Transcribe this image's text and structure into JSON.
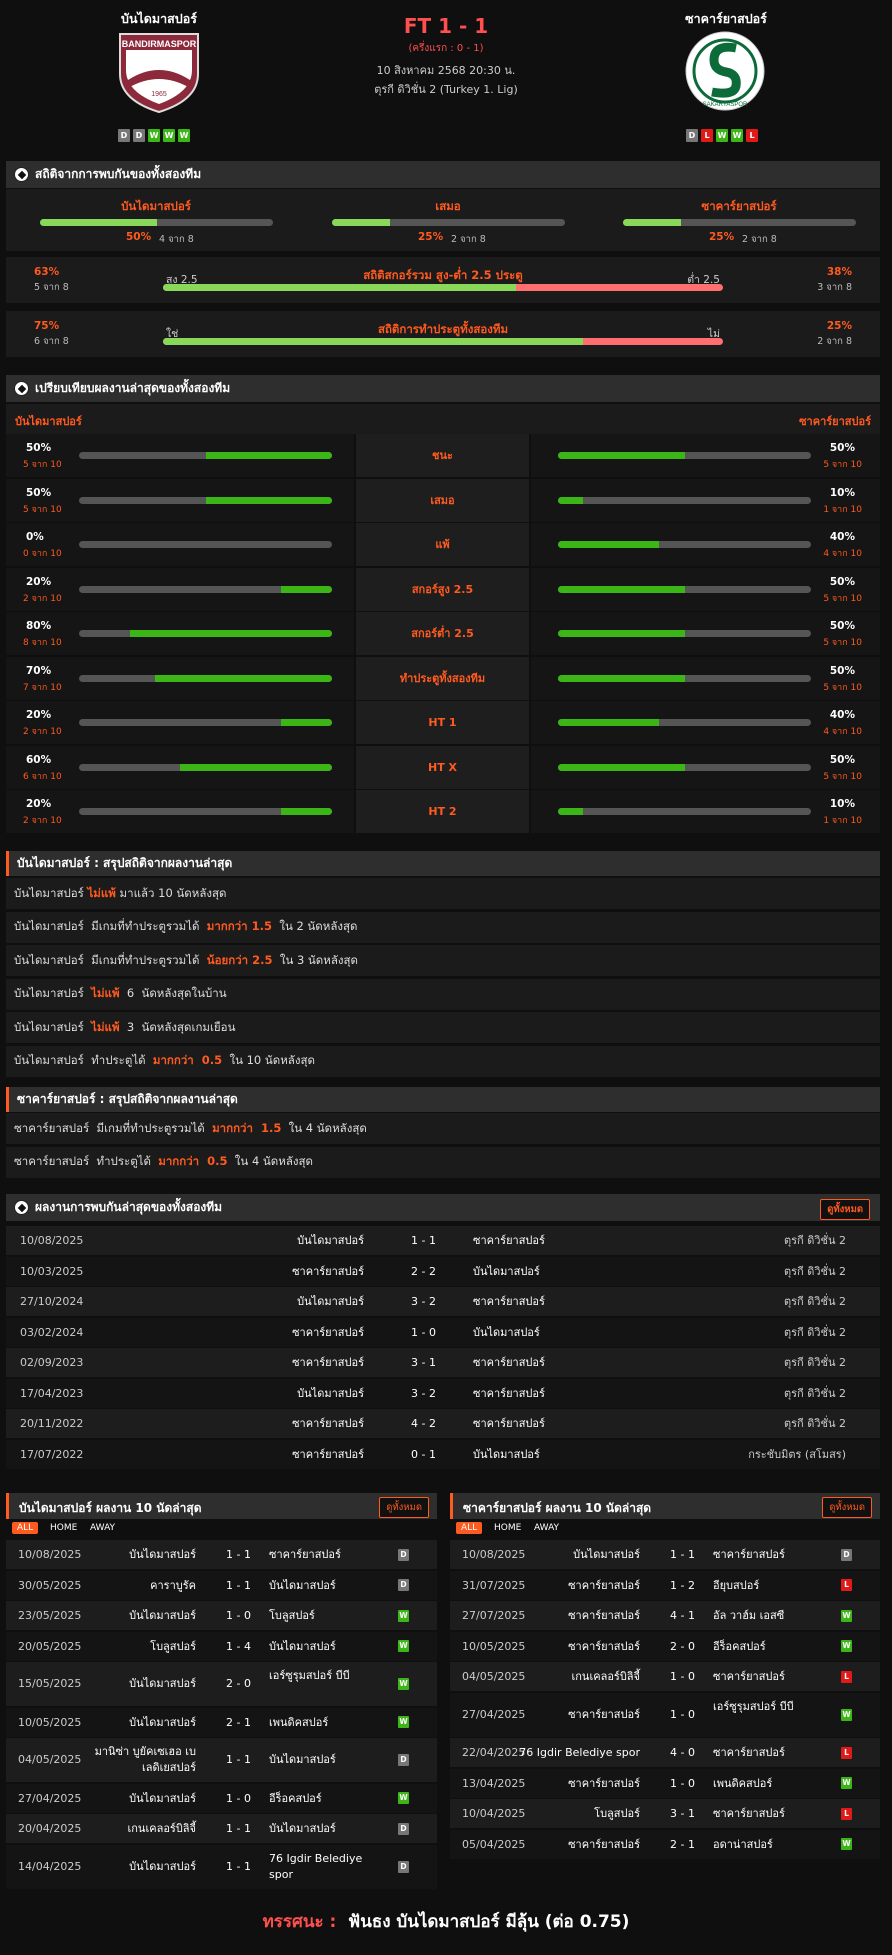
{
  "match": {
    "home": "บันไดมาสปอร์",
    "away": "ซาคาร์ยาสปอร์",
    "score": "FT 1 - 1",
    "half_time": "(ครึ่งแรก : 0 - 1)",
    "datetime": "10 สิงหาคม 2568 20:30 น.",
    "league": "ตุรกี ดิวิชั่น 2 (Turkey 1. Lig)",
    "home_logo_text": "BANDIRMASPOR",
    "home_logo_year": "1965",
    "away_logo_text": "SAKARYASPOR",
    "home_form": [
      "D",
      "D",
      "W",
      "W",
      "W"
    ],
    "away_form": [
      "D",
      "L",
      "W",
      "W",
      "L"
    ]
  },
  "h2h_stats": {
    "title": "สถิติจากการพบกันของทั้งสองทีม",
    "cols": [
      {
        "label": "บันไดมาสปอร์",
        "pct": "50%",
        "sub": "4 จาก 8",
        "value": 0.5
      },
      {
        "label": "เสมอ",
        "pct": "25%",
        "sub": "2 จาก 8",
        "value": 0.25
      },
      {
        "label": "ซาคาร์ยาสปอร์",
        "pct": "25%",
        "sub": "2 จาก 8",
        "value": 0.25
      }
    ],
    "over_under": {
      "title": "สถิติสกอร์รวม สูง-ต่ำ 2.5 ประตู",
      "left_label": "สูง 2.5",
      "right_label": "ต่ำ 2.5",
      "left_pct": "63%",
      "left_sub": "5 จาก 8",
      "right_pct": "38%",
      "right_sub": "3 จาก 8",
      "value": 0.63
    },
    "btts": {
      "title": "สถิติการทำประตูทั้งสองทีม",
      "left_label": "ใช่",
      "right_label": "ไม่",
      "left_pct": "75%",
      "left_sub": "6 จาก 8",
      "right_pct": "25%",
      "right_sub": "2 จาก 8",
      "value": 0.75
    }
  },
  "compare": {
    "title": "เปรียบเทียบผลงานล่าสุดของทั้งสองทีม",
    "home": "บันไดมาสปอร์",
    "away": "ซาคาร์ยาสปอร์",
    "rows": [
      {
        "label": "ชนะ",
        "hp": "50%",
        "hs": "5 จาก 10",
        "hv": 0.5,
        "ap": "50%",
        "as": "5 จาก 10",
        "av": 0.5
      },
      {
        "label": "เสมอ",
        "hp": "50%",
        "hs": "5 จาก 10",
        "hv": 0.5,
        "ap": "10%",
        "as": "1 จาก 10",
        "av": 0.1
      },
      {
        "label": "แพ้",
        "hp": "0%",
        "hs": "0 จาก 10",
        "hv": 0.0,
        "ap": "40%",
        "as": "4 จาก 10",
        "av": 0.4
      },
      {
        "label": "สกอร์สูง 2.5",
        "hp": "20%",
        "hs": "2 จาก 10",
        "hv": 0.2,
        "ap": "50%",
        "as": "5 จาก 10",
        "av": 0.5
      },
      {
        "label": "สกอร์ต่ำ 2.5",
        "hp": "80%",
        "hs": "8 จาก 10",
        "hv": 0.8,
        "ap": "50%",
        "as": "5 จาก 10",
        "av": 0.5
      },
      {
        "label": "ทำประตูทั้งสองทีม",
        "hp": "70%",
        "hs": "7 จาก 10",
        "hv": 0.7,
        "ap": "50%",
        "as": "5 จาก 10",
        "av": 0.5
      },
      {
        "label": "HT 1",
        "hp": "20%",
        "hs": "2 จาก 10",
        "hv": 0.2,
        "ap": "40%",
        "as": "4 จาก 10",
        "av": 0.4
      },
      {
        "label": "HT X",
        "hp": "60%",
        "hs": "6 จาก 10",
        "hv": 0.6,
        "ap": "50%",
        "as": "5 จาก 10",
        "av": 0.5
      },
      {
        "label": "HT 2",
        "hp": "20%",
        "hs": "2 จาก 10",
        "hv": 0.2,
        "ap": "10%",
        "as": "1 จาก 10",
        "av": 0.1
      }
    ]
  },
  "home_summary": {
    "title": "บันไดมาสปอร์ : สรุปสถิติจากผลงานล่าสุด",
    "rows": [
      [
        "บันไดมาสปอร์ ",
        "ไม่แพ้",
        " มาแล้ว 10 นัดหลังสุด"
      ],
      [
        "บันไดมาสปอร์  มีเกมที่ทำประตูรวมได้  ",
        "มากกว่า 1.5",
        "  ใน 2 นัดหลังสุด"
      ],
      [
        "บันไดมาสปอร์  มีเกมที่ทำประตูรวมได้  ",
        "น้อยกว่า 2.5",
        "  ใน 3 นัดหลังสุด"
      ],
      [
        "บันไดมาสปอร์  ",
        "ไม่แพ้",
        "  6  นัดหลังสุดในบ้าน"
      ],
      [
        "บันไดมาสปอร์  ",
        "ไม่แพ้",
        "  3  นัดหลังสุดเกมเยือน"
      ],
      [
        "บันไดมาสปอร์  ทำประตูได้  ",
        "มากกว่า  0.5",
        "  ใน 10 นัดหลังสุด"
      ]
    ]
  },
  "away_summary": {
    "title": "ซาคาร์ยาสปอร์ : สรุปสถิติจากผลงานล่าสุด",
    "rows": [
      [
        "ซาคาร์ยาสปอร์  มีเกมที่ทำประตูรวมได้  ",
        "มากกว่า  1.5",
        "  ใน 4 นัดหลังสุด"
      ],
      [
        "ซาคาร์ยาสปอร์  ทำประตูได้  ",
        "มากกว่า  0.5",
        "  ใน 4 นัดหลังสุด"
      ]
    ]
  },
  "h2h_results": {
    "title": "ผลงานการพบกันล่าสุดของทั้งสองทีม",
    "view_all": "ดูทั้งหมด",
    "rows": [
      [
        "10/08/2025",
        "บันไดมาสปอร์",
        "1 - 1",
        "ซาคาร์ยาสปอร์",
        "ตุรกี ดิวิชั่น 2"
      ],
      [
        "10/03/2025",
        "ซาคาร์ยาสปอร์",
        "2 - 2",
        "บันไดมาสปอร์",
        "ตุรกี ดิวิชั่น 2"
      ],
      [
        "27/10/2024",
        "บันไดมาสปอร์",
        "3 - 2",
        "ซาคาร์ยาสปอร์",
        "ตุรกี ดิวิชั่น 2"
      ],
      [
        "03/02/2024",
        "ซาคาร์ยาสปอร์",
        "1 - 0",
        "บันไดมาสปอร์",
        "ตุรกี ดิวิชั่น 2"
      ],
      [
        "02/09/2023",
        "ซาคาร์ยาสปอร์",
        "3 - 1",
        "ซาคาร์ยาสปอร์",
        "ตุรกี ดิวิชั่น 2"
      ],
      [
        "17/04/2023",
        "บันไดมาสปอร์",
        "3 - 2",
        "ซาคาร์ยาสปอร์",
        "ตุรกี ดิวิชั่น 2"
      ],
      [
        "20/11/2022",
        "ซาคาร์ยาสปอร์",
        "4 - 2",
        "ซาคาร์ยาสปอร์",
        "ตุรกี ดิวิชั่น 2"
      ],
      [
        "17/07/2022",
        "ซาคาร์ยาสปอร์",
        "0 - 1",
        "บันไดมาสปอร์",
        "กระชับมิตร (สโมสร)"
      ]
    ]
  },
  "home_last10": {
    "title": "บันไดมาสปอร์ ผลงาน 10 นัดล่าสุด",
    "view_all": "ดูทั้งหมด",
    "tabs": [
      "ALL",
      "HOME",
      "AWAY"
    ],
    "rows": [
      [
        "10/08/2025",
        "บันไดมาสปอร์",
        "1 - 1",
        "ซาคาร์ยาสปอร์",
        "D"
      ],
      [
        "30/05/2025",
        "คาราบูรัค",
        "1 - 1",
        "บันไดมาสปอร์",
        "D"
      ],
      [
        "23/05/2025",
        "บันไดมาสปอร์",
        "1 - 0",
        "โบลูสปอร์",
        "W"
      ],
      [
        "20/05/2025",
        "โบลูสปอร์",
        "1 - 4",
        "บันไดมาสปอร์",
        "W"
      ],
      [
        "15/05/2025",
        "บันไดมาสปอร์",
        "2 - 0",
        "เอร์ซูรุมสปอร์ บีบี",
        "W"
      ],
      [
        "10/05/2025",
        "บันไดมาสปอร์",
        "2 - 1",
        "เพนดิคสปอร์",
        "W"
      ],
      [
        "04/05/2025",
        "มานิซ่า บูยัคเซเฮอ เบเลดิเยสปอร์",
        "1 - 1",
        "บันไดมาสปอร์",
        "D"
      ],
      [
        "27/04/2025",
        "บันไดมาสปอร์",
        "1 - 0",
        "อีร็อคสปอร์",
        "W"
      ],
      [
        "20/04/2025",
        "เกนเคลอร์บิลิจี้",
        "1 - 1",
        "บันไดมาสปอร์",
        "D"
      ],
      [
        "14/04/2025",
        "บันไดมาสปอร์",
        "1 - 1",
        "76 Igdir Belediye spor",
        "D"
      ]
    ]
  },
  "away_last10": {
    "title": "ซาคาร์ยาสปอร์ ผลงาน 10 นัดล่าสุด",
    "view_all": "ดูทั้งหมด",
    "tabs": [
      "ALL",
      "HOME",
      "AWAY"
    ],
    "rows": [
      [
        "10/08/2025",
        "บันไดมาสปอร์",
        "1 - 1",
        "ซาคาร์ยาสปอร์",
        "D"
      ],
      [
        "31/07/2025",
        "ซาคาร์ยาสปอร์",
        "1 - 2",
        "อียุบสปอร์",
        "L"
      ],
      [
        "27/07/2025",
        "ซาคาร์ยาสปอร์",
        "4 - 1",
        "อัล วาฮ์ม เอสซี",
        "W"
      ],
      [
        "10/05/2025",
        "ซาคาร์ยาสปอร์",
        "2 - 0",
        "อีร็อคสปอร์",
        "W"
      ],
      [
        "04/05/2025",
        "เกนเคลอร์บิลิจี้",
        "1 - 0",
        "ซาคาร์ยาสปอร์",
        "L"
      ],
      [
        "27/04/2025",
        "ซาคาร์ยาสปอร์",
        "1 - 0",
        "เอร์ซูรุมสปอร์ บีบี",
        "W"
      ],
      [
        "22/04/2025",
        "76 Igdir Belediye spor",
        "4 - 0",
        "ซาคาร์ยาสปอร์",
        "L"
      ],
      [
        "13/04/2025",
        "ซาคาร์ยาสปอร์",
        "1 - 0",
        "เพนดิคสปอร์",
        "W"
      ],
      [
        "10/04/2025",
        "โบลูสปอร์",
        "3 - 1",
        "ซาคาร์ยาสปอร์",
        "L"
      ],
      [
        "05/04/2025",
        "ซาคาร์ยาสปอร์",
        "2 - 1",
        "อดาน่าสปอร์",
        "W"
      ]
    ]
  },
  "verdict": {
    "label": "ทรรศนะ :",
    "text": "ฟันธง บันไดมาสปอร์ มีลุ้น (ต่อ 0.75)"
  }
}
